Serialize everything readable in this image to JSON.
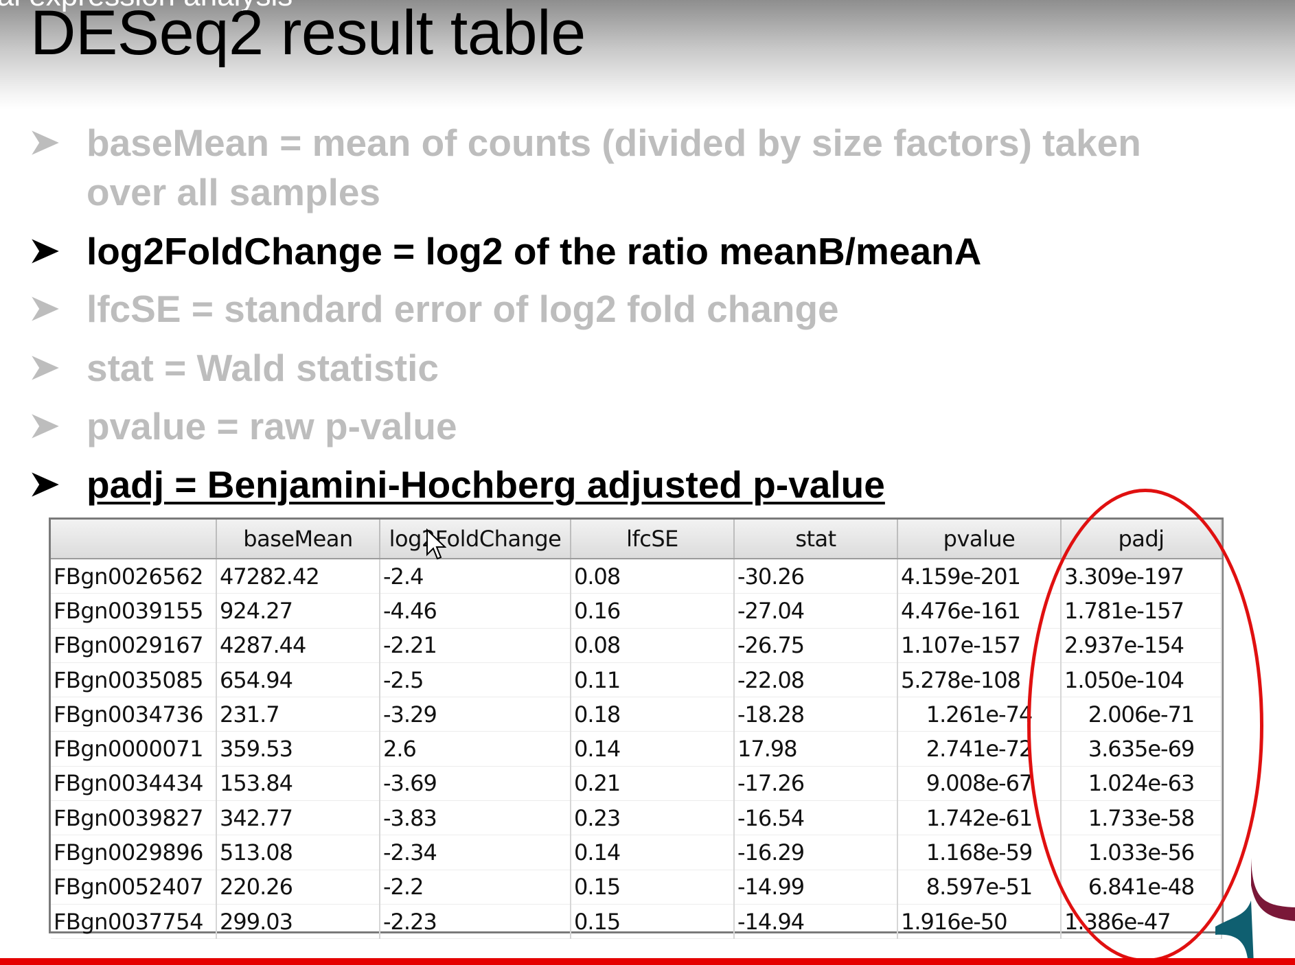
{
  "slide": {
    "cut_heading": "ial expression analysis",
    "title": "DESeq2 result table"
  },
  "bullets": [
    {
      "line1": "baseMean = mean of counts (divided by size factors) taken",
      "line2": "over all samples"
    },
    {
      "text": "log2FoldChange = log2 of the ratio meanB/meanA"
    },
    {
      "text": "lfcSE = standard error of log2 fold change"
    },
    {
      "text": "stat = Wald statistic"
    },
    {
      "text": "pvalue = raw p-value"
    },
    {
      "text": "padj = Benjamini-Hochberg adjusted p-value"
    }
  ],
  "table": {
    "headers": [
      "",
      "baseMean",
      "log2FoldChange",
      "lfcSE",
      "stat",
      "pvalue",
      "padj"
    ],
    "rows": [
      [
        "FBgn0026562",
        "47282.42",
        "-2.4",
        "0.08",
        "-30.26",
        "4.159e-201",
        "3.309e-197"
      ],
      [
        "FBgn0039155",
        "924.27",
        "-4.46",
        "0.16",
        "-27.04",
        "4.476e-161",
        "1.781e-157"
      ],
      [
        "FBgn0029167",
        "4287.44",
        "-2.21",
        "0.08",
        "-26.75",
        "1.107e-157",
        "2.937e-154"
      ],
      [
        "FBgn0035085",
        "654.94",
        "-2.5",
        "0.11",
        "-22.08",
        "5.278e-108",
        "1.050e-104"
      ],
      [
        "FBgn0034736",
        "231.7",
        "-3.29",
        "0.18",
        "-18.28",
        "1.261e-74",
        "2.006e-71"
      ],
      [
        "FBgn0000071",
        "359.53",
        "2.6",
        "0.14",
        "17.98",
        "2.741e-72",
        "3.635e-69"
      ],
      [
        "FBgn0034434",
        "153.84",
        "-3.69",
        "0.21",
        "-17.26",
        "9.008e-67",
        "1.024e-63"
      ],
      [
        "FBgn0039827",
        "342.77",
        "-3.83",
        "0.23",
        "-16.54",
        "1.742e-61",
        "1.733e-58"
      ],
      [
        "FBgn0029896",
        "513.08",
        "-2.34",
        "0.14",
        "-16.29",
        "1.168e-59",
        "1.033e-56"
      ],
      [
        "FBgn0052407",
        "220.26",
        "-2.2",
        "0.15",
        "-14.99",
        "8.597e-51",
        "6.841e-48"
      ],
      [
        "FBgn0037754",
        "299.03",
        "-2.23",
        "0.15",
        "-14.94",
        "1.916e-50",
        "1.386e-47"
      ]
    ]
  },
  "colors": {
    "highlight_circle": "#e01010",
    "muted_text": "#bdbdbd",
    "bottom_bar": "#e50000"
  }
}
